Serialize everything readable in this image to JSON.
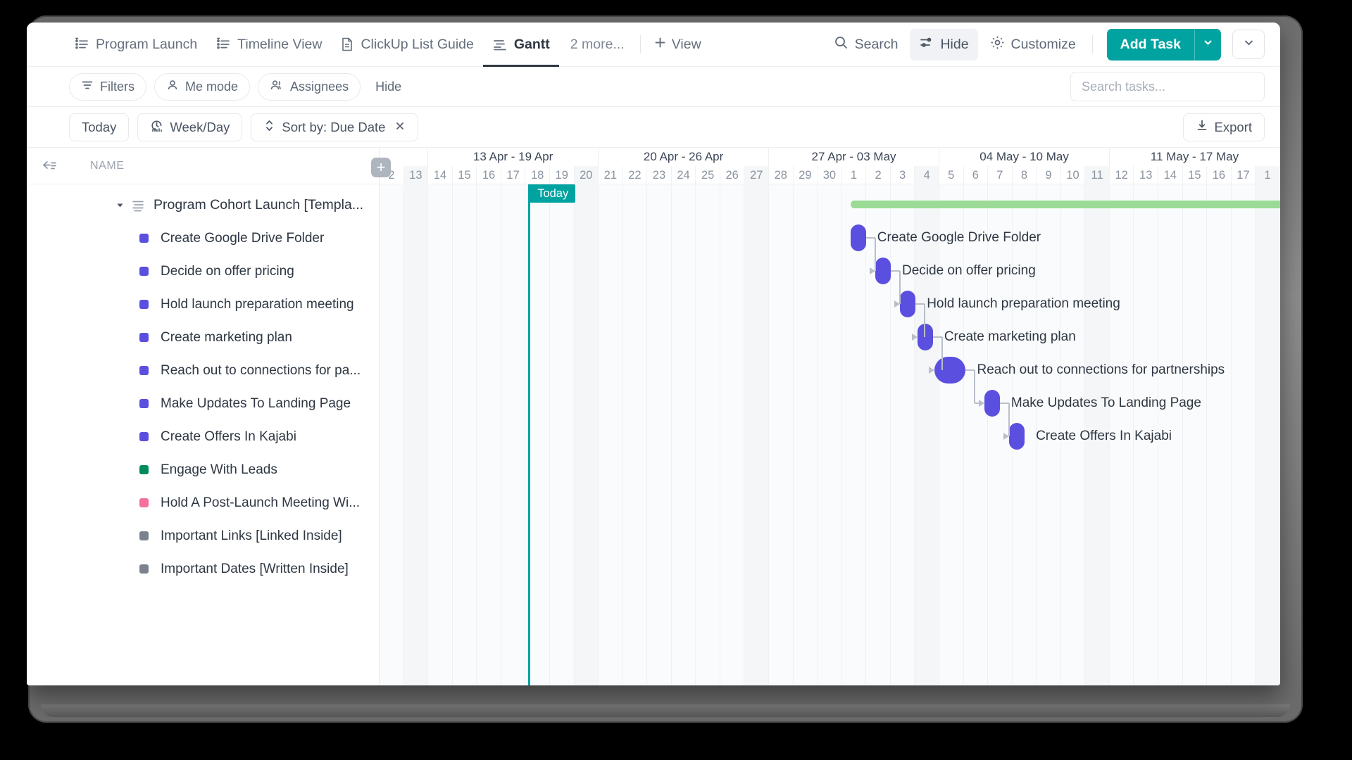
{
  "view_bar": {
    "tabs": [
      {
        "label": "Program Launch",
        "icon": "pinned-list-icon",
        "active": false
      },
      {
        "label": "Timeline View",
        "icon": "pinned-list-icon",
        "active": false
      },
      {
        "label": "ClickUp List Guide",
        "icon": "doc-icon",
        "active": false
      },
      {
        "label": "Gantt",
        "icon": "gantt-icon",
        "active": true
      }
    ],
    "more_views": "2 more...",
    "add_view": "View",
    "add_view_icon": "plus-icon",
    "search": "Search",
    "search_icon": "search-icon",
    "hide": "Hide",
    "hide_icon": "sliders-icon",
    "customize": "Customize",
    "customize_icon": "gear-icon",
    "add_task": "Add Task",
    "add_task_caret_icon": "chevron-down-icon",
    "overflow_caret_icon": "chevron-down-icon",
    "accent_color": "#00A3A0"
  },
  "filter_bar": {
    "filters": "Filters",
    "filters_icon": "filter-icon",
    "me_mode": "Me mode",
    "me_mode_icon": "person-icon",
    "assignees": "Assignees",
    "assignees_icon": "people-icon",
    "hide": "Hide",
    "search_placeholder": "Search tasks..."
  },
  "control_bar": {
    "today": "Today",
    "zoom": "Week/Day",
    "zoom_icon": "clock-chart-icon",
    "sort": "Sort by: Due Date",
    "sort_icon": "sort-icon",
    "sort_clear_icon": "close-icon",
    "export": "Export",
    "export_icon": "download-icon"
  },
  "left_panel": {
    "collapse_icon": "collapse-left-icon",
    "name_column": "NAME",
    "add_column_icon": "plus-icon"
  },
  "timeline": {
    "today_label": "Today",
    "weeks": [
      {
        "label": "",
        "days": 2,
        "partial_start": true
      },
      {
        "label": "13 Apr - 19 Apr",
        "days": 7
      },
      {
        "label": "20 Apr - 26 Apr",
        "days": 7
      },
      {
        "label": "27 Apr - 03 May",
        "days": 7
      },
      {
        "label": "04 May - 10 May",
        "days": 7
      },
      {
        "label": "11 May - 17 May",
        "days": 7
      }
    ],
    "days": [
      "2",
      "13",
      "14",
      "15",
      "16",
      "17",
      "18",
      "19",
      "20",
      "21",
      "22",
      "23",
      "24",
      "25",
      "26",
      "27",
      "28",
      "29",
      "30",
      "1",
      "2",
      "3",
      "4",
      "5",
      "6",
      "7",
      "8",
      "9",
      "10",
      "11",
      "12",
      "13",
      "14",
      "15",
      "16",
      "17",
      "1"
    ],
    "weekend_indices": [
      1,
      8,
      15,
      22,
      29,
      36
    ]
  },
  "tasks": {
    "group": {
      "name": "Program Cohort Launch [Templa...",
      "expanded": true,
      "twisty_icon": "chevron-down-icon",
      "list_icon": "subtask-list-icon",
      "summary_color": "#9BDB95",
      "summary_start_day": 19,
      "summary_span_days": 18
    },
    "items": [
      {
        "name": "Create Google Drive Folder",
        "color": "#5B4FE0",
        "bar_start": 19.0,
        "bar_width_days": 0.62,
        "gantt_label": "Create Google Drive Folder"
      },
      {
        "name": "Decide on offer pricing",
        "color": "#5B4FE0",
        "bar_start": 20.0,
        "bar_width_days": 0.62,
        "gantt_label": "Decide on offer pricing"
      },
      {
        "name": "Hold launch preparation meeting",
        "color": "#5B4FE0",
        "bar_start": 21.0,
        "bar_width_days": 0.62,
        "gantt_label": "Hold launch preparation meeting"
      },
      {
        "name": "Create marketing plan",
        "color": "#5B4FE0",
        "bar_start": 21.7,
        "bar_width_days": 0.62,
        "gantt_label": "Create marketing plan"
      },
      {
        "name": "Reach out to connections for pa...",
        "color": "#5B4FE0",
        "bar_start": 22.4,
        "bar_width_days": 1.25,
        "gantt_label": "Reach out to connections for partnerships"
      },
      {
        "name": "Make Updates To Landing Page",
        "color": "#5B4FE0",
        "bar_start": 24.4,
        "bar_width_days": 0.62,
        "gantt_label": "Make Updates To Landing Page"
      },
      {
        "name": "Create Offers In Kajabi",
        "color": "#5B4FE0",
        "bar_start": 25.4,
        "bar_width_days": 0.62,
        "gantt_label": "Create Offers In Kajabi"
      },
      {
        "name": "Engage With Leads",
        "color": "#018A5B",
        "bar_start": null,
        "bar_width_days": 0,
        "gantt_label": ""
      },
      {
        "name": "Hold A Post-Launch Meeting Wi...",
        "color": "#F56FA0",
        "bar_start": null,
        "bar_width_days": 0,
        "gantt_label": ""
      },
      {
        "name": "Important Links [Linked Inside]",
        "color": "#7C828D",
        "bar_start": null,
        "bar_width_days": 0,
        "gantt_label": ""
      },
      {
        "name": "Important Dates [Written Inside]",
        "color": "#7C828D",
        "bar_start": null,
        "bar_width_days": 0,
        "gantt_label": ""
      }
    ]
  }
}
